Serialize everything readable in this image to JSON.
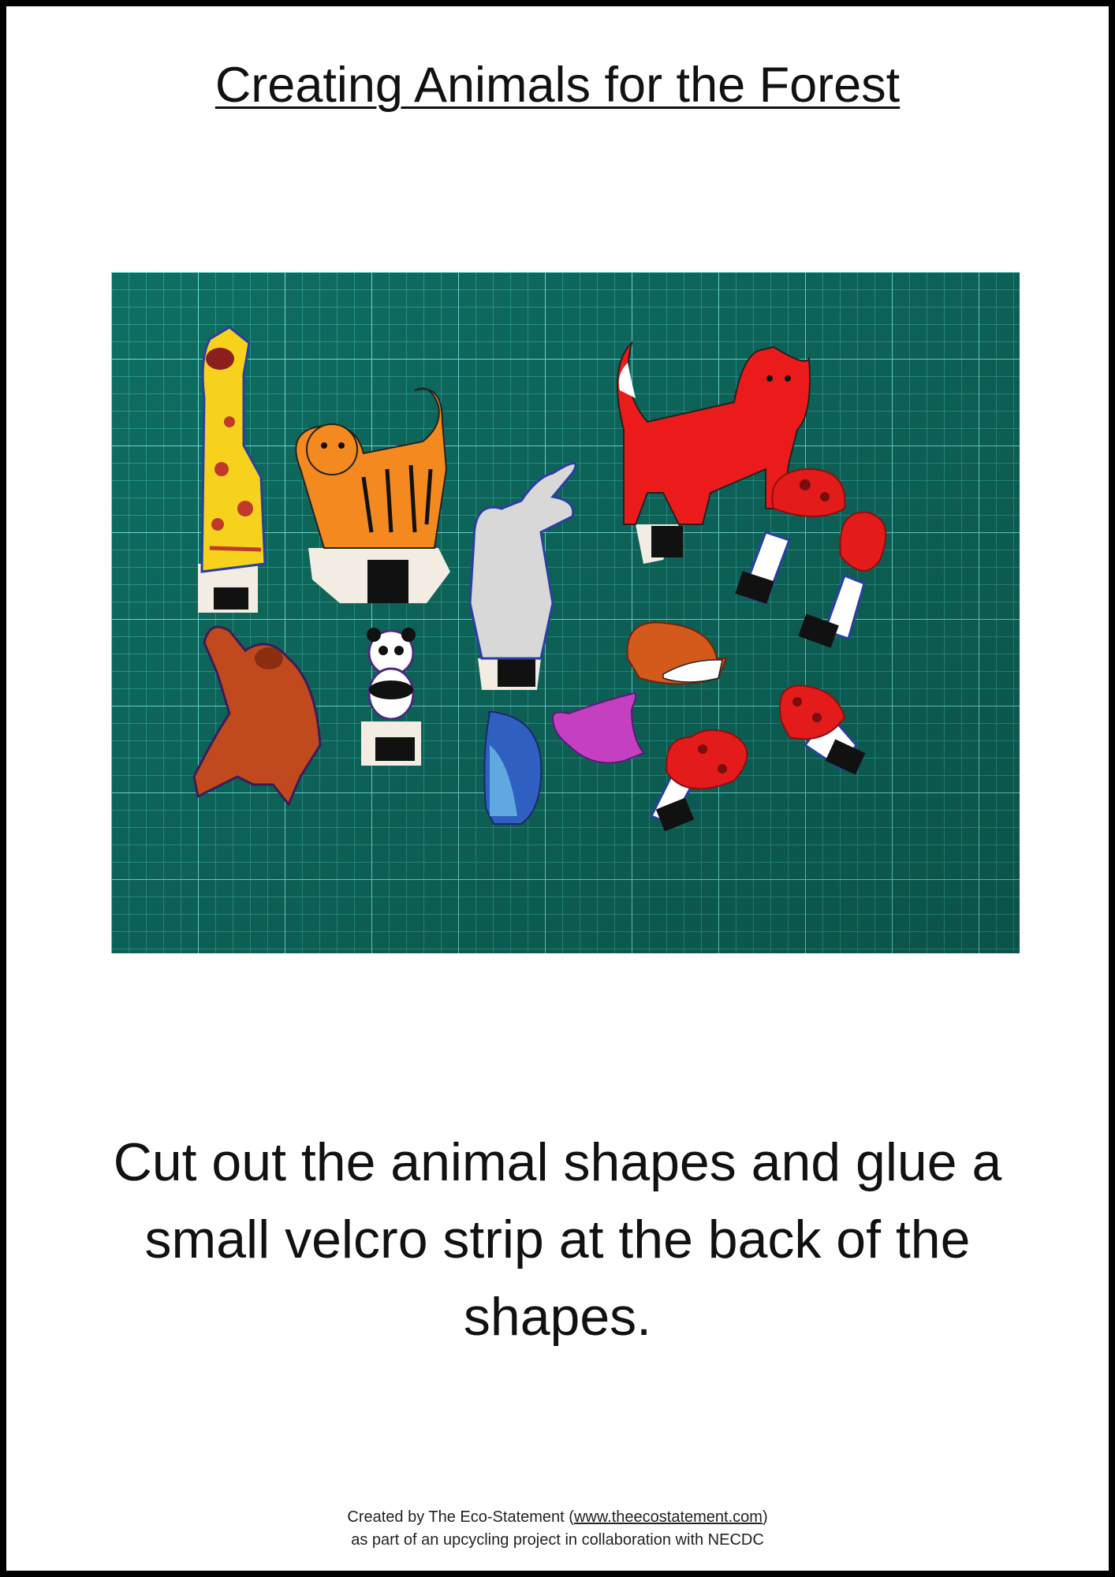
{
  "title": "Creating Animals for the Forest",
  "photo": {
    "background_color": "#0f6e62",
    "grid_color": "#45c9c0",
    "pieces": [
      "giraffe",
      "tiger",
      "elephant",
      "fox",
      "mushroom",
      "mushroom",
      "orangutan",
      "panda",
      "hedgehog",
      "blue-bird",
      "pink-bird",
      "mushroom",
      "mushroom"
    ]
  },
  "instruction": "Cut out the animal shapes and glue a small velcro strip at the back of the shapes.",
  "credits": {
    "line1_prefix": "Created by The Eco-Statement (",
    "link": "www.theecostatement.com",
    "line1_suffix": ")",
    "line2": "as part of an upcycling project in collaboration with NECDC"
  }
}
